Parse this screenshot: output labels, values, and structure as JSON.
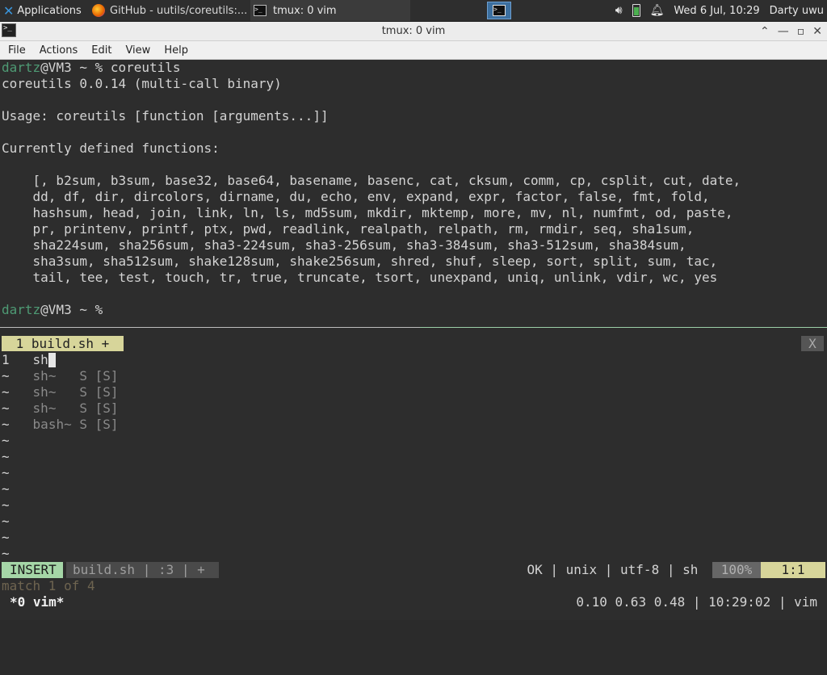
{
  "panel": {
    "applications_label": "Applications",
    "tasks": [
      {
        "label": "GitHub - uutils/coreutils:..."
      },
      {
        "label": "tmux: 0 vim"
      }
    ],
    "clock": "Wed  6 Jul, 10:29",
    "user": "Darty uwu"
  },
  "window": {
    "title": "tmux: 0 vim",
    "minimize": "⌃",
    "maximize": "—",
    "restore": "▫",
    "close": "✕"
  },
  "menu": [
    "File",
    "Actions",
    "Edit",
    "View",
    "Help"
  ],
  "terminal": {
    "prompt_user": "dartz",
    "prompt_host": "@VM3 ~ %",
    "command": " coreutils",
    "lines": [
      "coreutils 0.0.14 (multi-call binary)",
      "",
      "Usage: coreutils [function [arguments...]]",
      "",
      "Currently defined functions:",
      "",
      "    [, b2sum, b3sum, base32, base64, basename, basenc, cat, cksum, comm, cp, csplit, cut, date,",
      "    dd, df, dir, dircolors, dirname, du, echo, env, expand, expr, factor, false, fmt, fold,",
      "    hashsum, head, join, link, ln, ls, md5sum, mkdir, mktemp, more, mv, nl, numfmt, od, paste,",
      "    pr, printenv, printf, ptx, pwd, readlink, realpath, relpath, rm, rmdir, seq, sha1sum,",
      "    sha224sum, sha256sum, sha3-224sum, sha3-256sum, sha3-384sum, sha3-512sum, sha384sum,",
      "    sha3sum, sha512sum, shake128sum, shake256sum, shred, shuf, sleep, sort, split, sum, tac,",
      "    tail, tee, test, touch, tr, true, truncate, tsort, unexpand, uniq, unlink, vdir, wc, yes",
      ""
    ],
    "prompt2_user": "dartz",
    "prompt2_host": "@VM3 ~ %"
  },
  "vim": {
    "tab_label": " 1 build.sh + ",
    "tab_close": "X",
    "line_number": "1",
    "line_text": "sh",
    "completions": [
      {
        "word": "sh~  ",
        "kind": " S [S]"
      },
      {
        "word": "sh~  ",
        "kind": " S [S]"
      },
      {
        "word": "sh~  ",
        "kind": " S [S]"
      },
      {
        "word": "bash~",
        "kind": " S [S]"
      }
    ],
    "tilde": "~",
    "status": {
      "mode": "INSERT",
      "file": "build.sh | :3 | + ",
      "right": "OK | unix | utf-8 | sh ",
      "percent": "100%",
      "position": "1:1"
    },
    "message": "match 1 of 4"
  },
  "tmux": {
    "left": "*0 vim*",
    "right": "0.10 0.63 0.48 | 10:29:02 | vim"
  }
}
